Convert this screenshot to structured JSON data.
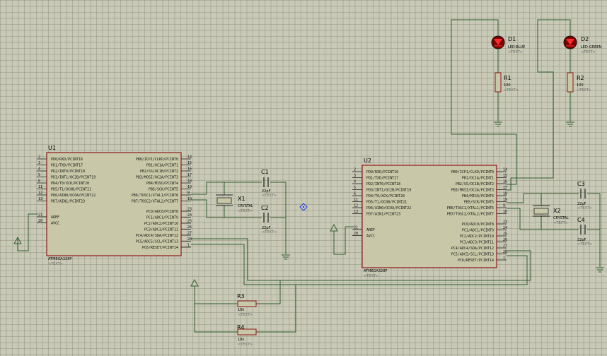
{
  "schematic": {
    "u1": {
      "ref": "U1",
      "part": "ATMEGA328P",
      "text": "<TEXT>",
      "left_pins": [
        {
          "num": "2",
          "name": "PD0/RXD/PCINT16"
        },
        {
          "num": "3",
          "name": "PD1/TXD/PCINT17"
        },
        {
          "num": "4",
          "name": "PD2/INT0/PCINT18"
        },
        {
          "num": "5",
          "name": "PD3/INT1/OC2B/PCINT19"
        },
        {
          "num": "6",
          "name": "PD4/T0/XCK/PCINT20"
        },
        {
          "num": "11",
          "name": "PD5/T1/OC0B/PCINT21"
        },
        {
          "num": "12",
          "name": "PD6/AIN0/OC0A/PCINT22"
        },
        {
          "num": "13",
          "name": "PD7/AIN1/PCINT23"
        },
        {
          "num": "21",
          "name": "AREF"
        },
        {
          "num": "20",
          "name": "AVCC"
        }
      ],
      "right_pins": [
        {
          "num": "14",
          "name": "PB0/ICP1/CLKO/PCINT0"
        },
        {
          "num": "15",
          "name": "PB1/OC1A/PCINT1"
        },
        {
          "num": "16",
          "name": "PB2/SS/OC1B/PCINT2"
        },
        {
          "num": "17",
          "name": "PB3/MOSI/OC2A/PCINT3"
        },
        {
          "num": "18",
          "name": "PB4/MISO/PCINT4"
        },
        {
          "num": "19",
          "name": "PB5/SCK/PCINT5"
        },
        {
          "num": "9",
          "name": "PB6/TOSC1/XTAL1/PCINT6"
        },
        {
          "num": "10",
          "name": "PB7/TOSC2/XTAL2/PCINT7"
        },
        {
          "num": "23",
          "name": "PC0/ADC0/PCINT8"
        },
        {
          "num": "24",
          "name": "PC1/ADC1/PCINT9"
        },
        {
          "num": "25",
          "name": "PC2/ADC2/PCINT10"
        },
        {
          "num": "26",
          "name": "PC3/ADC3/PCINT11"
        },
        {
          "num": "27",
          "name": "PC4/ADC4/SDA/PCINT12"
        },
        {
          "num": "28",
          "name": "PC5/ADC5/SCL/PCINT13"
        },
        {
          "num": "1",
          "name": "PC6/RESET/PCINT14"
        }
      ]
    },
    "u2": {
      "ref": "U2",
      "part": "ATMEGA328P",
      "text": "<TEXT>"
    },
    "x1": {
      "ref": "X1",
      "value": "CRYSTAL",
      "text": "<TEXT>"
    },
    "x2": {
      "ref": "X2",
      "value": "CRYSTAL",
      "text": "<TEXT>"
    },
    "c1": {
      "ref": "C1",
      "value": "22pF",
      "text": "<TEXT>"
    },
    "c2": {
      "ref": "C2",
      "value": "22pF",
      "text": "<TEXT>"
    },
    "c3": {
      "ref": "C3",
      "value": "22pF",
      "text": "<TEXT>"
    },
    "c4": {
      "ref": "C4",
      "value": "22pF",
      "text": "<TEXT>"
    },
    "d1": {
      "ref": "D1",
      "value": "LED-BLUE",
      "text": "<TEXT>"
    },
    "d2": {
      "ref": "D2",
      "value": "LED-GREEN",
      "text": "<TEXT>"
    },
    "r1": {
      "ref": "R1",
      "value": "100",
      "text": "<TEXT>"
    },
    "r2": {
      "ref": "R2",
      "value": "100",
      "text": "<TEXT>"
    },
    "r3": {
      "ref": "R3",
      "value": "10k",
      "text": "<TEXT>"
    },
    "r4": {
      "ref": "R4",
      "value": "10k",
      "text": "<TEXT>"
    }
  },
  "colors": {
    "grid_bg": "#c9c9b7",
    "chip_fill": "#c8c8a8",
    "chip_border": "#8b1a1a",
    "wire": "#2f5f2f",
    "led": "#cc0000"
  }
}
